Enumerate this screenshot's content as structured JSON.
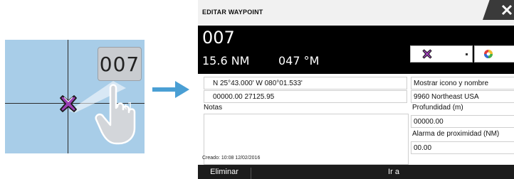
{
  "illustration": {
    "tooltip_label": "007",
    "tap_count": "x1",
    "marker_icon": "waypoint-x-icon",
    "hand_icon": "hand-pointer-icon",
    "arrow_icon": "arrow-right-icon",
    "map_color": "#a8cde8",
    "arrow_color": "#4a9fd4"
  },
  "dialog": {
    "title": "EDITAR WAYPOINT",
    "name": "007",
    "distance": "15.6 NM",
    "bearing": "047 °M",
    "icon_select": {
      "icon": "waypoint-x-icon",
      "color": "#9b3fb5"
    },
    "color_select": {
      "icon": "color-wheel-icon"
    },
    "position_lat_lon": "N 25°43.000'  W 080°01.533'",
    "position_xy": "00000.00  27125.95",
    "notes_label": "Notas",
    "display_option": "Mostrar icono y nombre",
    "datum": "9960 Northeast USA",
    "depth_label": "Profundidad (m)",
    "depth_value": "00000.00",
    "proximity_label": "Alarma de proximidad (NM)",
    "proximity_value": "00.00",
    "created": "Creado: 10:08  12/02/2016",
    "footer": {
      "delete_label": "Eliminar",
      "goto_label": "Ir a"
    }
  }
}
